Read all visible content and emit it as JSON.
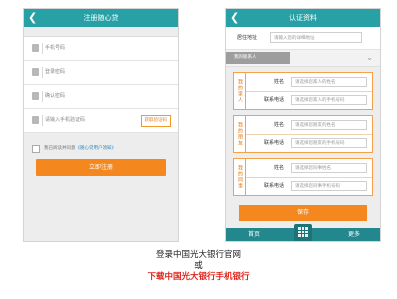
{
  "register_screen": {
    "title": "注册随心贷",
    "fields": [
      {
        "placeholder": "手机号码"
      },
      {
        "placeholder": "登录密码"
      },
      {
        "placeholder": "确认密码"
      },
      {
        "placeholder": "请输入手机验证码",
        "action": "获取验证码"
      }
    ],
    "agreement_prefix": "我已阅读并同意",
    "agreement_link": "《随心贷用户须知》",
    "submit_label": "立即注册"
  },
  "verify_screen": {
    "title": "认证资料",
    "address_label": "居住地址",
    "address_placeholder": "请输入您的详细地址",
    "contacts_select": "我的联系人",
    "groups": [
      {
        "tag": "我的家人",
        "name_label": "姓名",
        "name_placeholder": "请选择您家人的姓名",
        "phone_label": "联系电话",
        "phone_placeholder": "请选择您家人的手机号码"
      },
      {
        "tag": "我的朋友",
        "name_label": "姓名",
        "name_placeholder": "请选择您朋友的姓名",
        "phone_label": "联系电话",
        "phone_placeholder": "请选择您朋友的手机号码"
      },
      {
        "tag": "我的同事",
        "name_label": "姓名",
        "name_placeholder": "请选择您同事姓名",
        "phone_label": "联系电话",
        "phone_placeholder": "请选择您同事手机号码"
      }
    ],
    "save_label": "保存",
    "tabs": {
      "home": "首页",
      "more": "更多"
    }
  },
  "captions": {
    "line1": "登录中国光大银行官网",
    "line2": "或",
    "line3": "下载中国光大银行手机银行"
  },
  "colors": {
    "header": "#27a0a6",
    "accent": "#f5871f",
    "tabbar": "#23888d",
    "link_red": "#e0241b"
  },
  "icons": [
    "back-arrow-icon",
    "user-icon",
    "lock-icon",
    "sms-icon",
    "checkbox-icon",
    "chevron-down-icon",
    "grid-menu-icon"
  ]
}
